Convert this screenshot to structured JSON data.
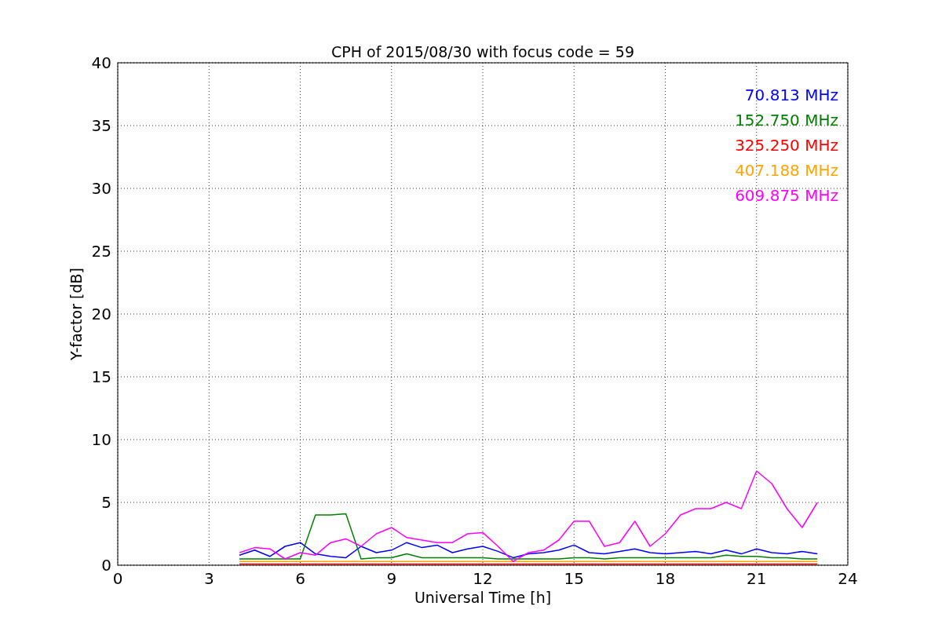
{
  "chart": {
    "chart_data": {
      "type": "line",
      "title": "CPH of 2015/08/30 with focus code = 59",
      "xlabel": "Universal Time [h]",
      "ylabel": "Y-factor [dB]",
      "x": [
        4,
        4.5,
        5,
        5.5,
        6,
        6.5,
        7,
        7.5,
        8,
        8.5,
        9,
        9.5,
        10,
        10.5,
        11,
        11.5,
        12,
        12.5,
        13,
        13.5,
        14,
        14.5,
        15,
        15.5,
        16,
        16.5,
        17,
        17.5,
        18,
        18.5,
        19,
        19.5,
        20,
        20.5,
        21,
        21.5,
        22,
        22.5,
        23
      ],
      "series": [
        {
          "name": "70.813 MHz",
          "color": "#0000ff",
          "values": [
            0.8,
            1.2,
            0.7,
            1.5,
            1.8,
            0.9,
            0.7,
            0.6,
            1.5,
            1.0,
            1.2,
            1.8,
            1.4,
            1.6,
            1.0,
            1.3,
            1.5,
            1.1,
            0.6,
            0.9,
            1.0,
            1.2,
            1.6,
            1.0,
            0.9,
            1.1,
            1.3,
            1.0,
            0.9,
            1.0,
            1.1,
            0.9,
            1.2,
            0.9,
            1.3,
            1.0,
            0.9,
            1.1,
            0.9
          ]
        },
        {
          "name": "152.750 MHz",
          "color": "#008000",
          "values": [
            0.5,
            0.5,
            0.5,
            0.5,
            0.5,
            4.0,
            4.0,
            4.1,
            0.5,
            0.6,
            0.6,
            0.9,
            0.6,
            0.6,
            0.6,
            0.6,
            0.6,
            0.5,
            0.5,
            0.5,
            0.5,
            0.5,
            0.6,
            0.6,
            0.5,
            0.6,
            0.6,
            0.6,
            0.6,
            0.6,
            0.6,
            0.6,
            0.8,
            0.7,
            0.7,
            0.6,
            0.6,
            0.5,
            0.5
          ]
        },
        {
          "name": "325.250 MHz",
          "color": "#ff0000",
          "values": [
            0.1,
            0.1,
            0.1,
            0.1,
            0.1,
            0.1,
            0.1,
            0.1,
            0.1,
            0.1,
            0.1,
            0.1,
            0.1,
            0.1,
            0.1,
            0.1,
            0.1,
            0.1,
            0.1,
            0.1,
            0.1,
            0.1,
            0.1,
            0.1,
            0.1,
            0.1,
            0.1,
            0.1,
            0.1,
            0.1,
            0.1,
            0.1,
            0.1,
            0.1,
            0.1,
            0.1,
            0.1,
            0.1,
            0.1
          ]
        },
        {
          "name": "407.188 MHz",
          "color": "#ffa500",
          "values": [
            0.3,
            0.3,
            0.3,
            0.3,
            0.3,
            0.3,
            0.3,
            0.3,
            0.3,
            0.3,
            0.3,
            0.3,
            0.3,
            0.3,
            0.3,
            0.3,
            0.3,
            0.3,
            0.3,
            0.3,
            0.3,
            0.3,
            0.3,
            0.3,
            0.3,
            0.3,
            0.3,
            0.3,
            0.3,
            0.3,
            0.3,
            0.3,
            0.3,
            0.3,
            0.3,
            0.3,
            0.3,
            0.3,
            0.3
          ]
        },
        {
          "name": "609.875 MHz",
          "color": "#ff00ff",
          "values": [
            1.0,
            1.4,
            1.3,
            0.5,
            1.0,
            0.8,
            1.8,
            2.1,
            1.5,
            2.5,
            3.0,
            2.2,
            2.0,
            1.8,
            1.8,
            2.5,
            2.6,
            1.5,
            0.3,
            1.0,
            1.2,
            2.0,
            3.5,
            3.5,
            1.5,
            1.8,
            3.5,
            1.5,
            2.5,
            4.0,
            4.5,
            4.5,
            5.0,
            4.5,
            7.5,
            6.5,
            4.5,
            3.0,
            5.0
          ]
        }
      ],
      "xlim": [
        0,
        24
      ],
      "ylim": [
        0,
        40
      ],
      "xticks": [
        0,
        3,
        6,
        9,
        12,
        15,
        18,
        21,
        24
      ],
      "yticks": [
        0,
        5,
        10,
        15,
        20,
        25,
        30,
        35,
        40
      ],
      "grid": true
    }
  }
}
